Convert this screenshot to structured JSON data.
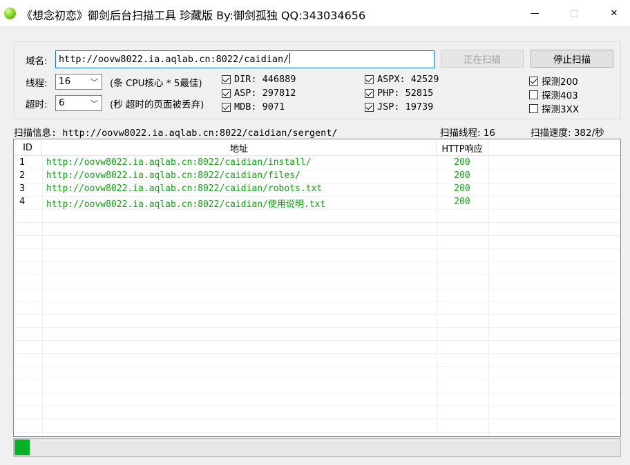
{
  "window": {
    "title": "《想念初恋》御剑后台扫描工具 珍藏版 By:御剑孤独 QQ:343034656",
    "icon": "green-orb-icon",
    "minimize_glyph": "—",
    "maximize_glyph": "□",
    "close_glyph": "✕"
  },
  "config": {
    "domain_label": "域名:",
    "domain_value": "http://oovw8022.ia.aqlab.cn:8022/caidian/",
    "scanning_button": "正在扫描",
    "stop_button": "停止扫描",
    "threads_label": "线程:",
    "threads_value": "16",
    "threads_note": "(条 CPU核心 * 5最佳)",
    "timeout_label": "超时:",
    "timeout_value": "6",
    "timeout_note": "(秒 超时的页面被丢弃)"
  },
  "dictionaries": [
    {
      "label": "DIR: 446889",
      "checked": true
    },
    {
      "label": "ASP: 297812",
      "checked": true
    },
    {
      "label": "MDB: 9071",
      "checked": true
    },
    {
      "label": "ASPX: 42529",
      "checked": true
    },
    {
      "label": "PHP: 52815",
      "checked": true
    },
    {
      "label": "JSP: 19739",
      "checked": true
    }
  ],
  "probes": [
    {
      "label": "探测200",
      "checked": true
    },
    {
      "label": "探测403",
      "checked": false
    },
    {
      "label": "探测3XX",
      "checked": false
    }
  ],
  "status": {
    "info": "扫描信息: http://oovw8022.ia.aqlab.cn:8022/caidian/sergent/",
    "threads": "扫描线程: 16",
    "speed": "扫描速度: 382/秒"
  },
  "table": {
    "columns": [
      "ID",
      "地址",
      "HTTP响应"
    ],
    "rows": [
      {
        "id": "1",
        "url": "http://oovw8022.ia.aqlab.cn:8022/caidian/install/",
        "code": "200"
      },
      {
        "id": "2",
        "url": "http://oovw8022.ia.aqlab.cn:8022/caidian/files/",
        "code": "200"
      },
      {
        "id": "3",
        "url": "http://oovw8022.ia.aqlab.cn:8022/caidian/robots.txt",
        "code": "200"
      },
      {
        "id": "4",
        "url": "http://oovw8022.ia.aqlab.cn:8022/caidian/使用说明.txt",
        "code": "200"
      }
    ],
    "result_color": "#11a011"
  },
  "progress": {
    "fraction": 0.025,
    "color": "#06b025"
  }
}
